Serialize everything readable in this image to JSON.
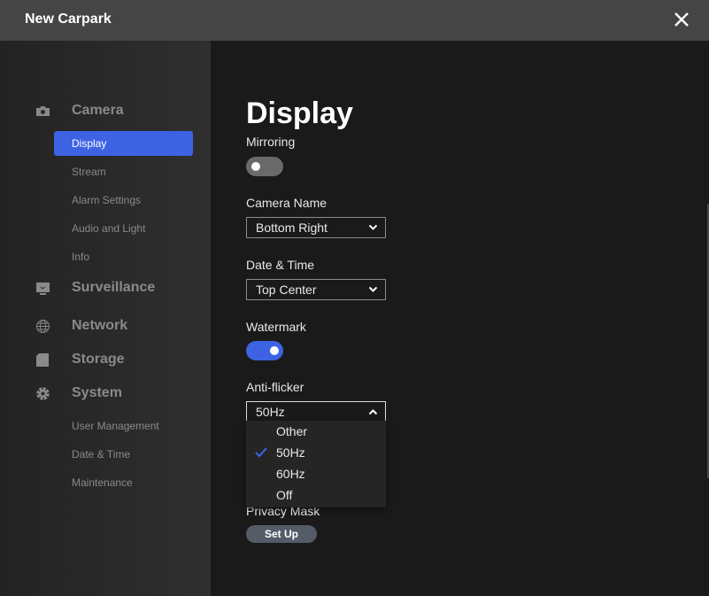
{
  "window": {
    "title": "New Carpark",
    "close_icon": "close-icon"
  },
  "sidebar": {
    "sections": [
      {
        "label": "Camera",
        "icon": "camera-icon",
        "items": [
          {
            "label": "Display",
            "active": true
          },
          {
            "label": "Stream"
          },
          {
            "label": "Alarm Settings"
          },
          {
            "label": "Audio and Light"
          },
          {
            "label": "Info"
          }
        ]
      },
      {
        "label": "Surveillance",
        "icon": "monitor-icon"
      },
      {
        "label": "Network",
        "icon": "globe-icon"
      },
      {
        "label": "Storage",
        "icon": "sd-card-icon"
      },
      {
        "label": "System",
        "icon": "gear-icon",
        "items": [
          {
            "label": "User Management"
          },
          {
            "label": "Date & Time"
          },
          {
            "label": "Maintenance"
          }
        ]
      }
    ]
  },
  "main": {
    "title": "Display",
    "mirroring": {
      "label": "Mirroring",
      "on": false
    },
    "camera_name": {
      "label": "Camera Name",
      "value": "Bottom Right"
    },
    "date_time": {
      "label": "Date & Time",
      "value": "Top Center"
    },
    "watermark": {
      "label": "Watermark",
      "on": true
    },
    "anti_flicker": {
      "label": "Anti-flicker",
      "value": "50Hz",
      "options": [
        "Other",
        "50Hz",
        "60Hz",
        "Off"
      ],
      "selected": "50Hz"
    },
    "privacy_mask": {
      "label": "Privacy Mask",
      "button": "Set Up"
    }
  },
  "colors": {
    "accent": "#3d63e3"
  }
}
